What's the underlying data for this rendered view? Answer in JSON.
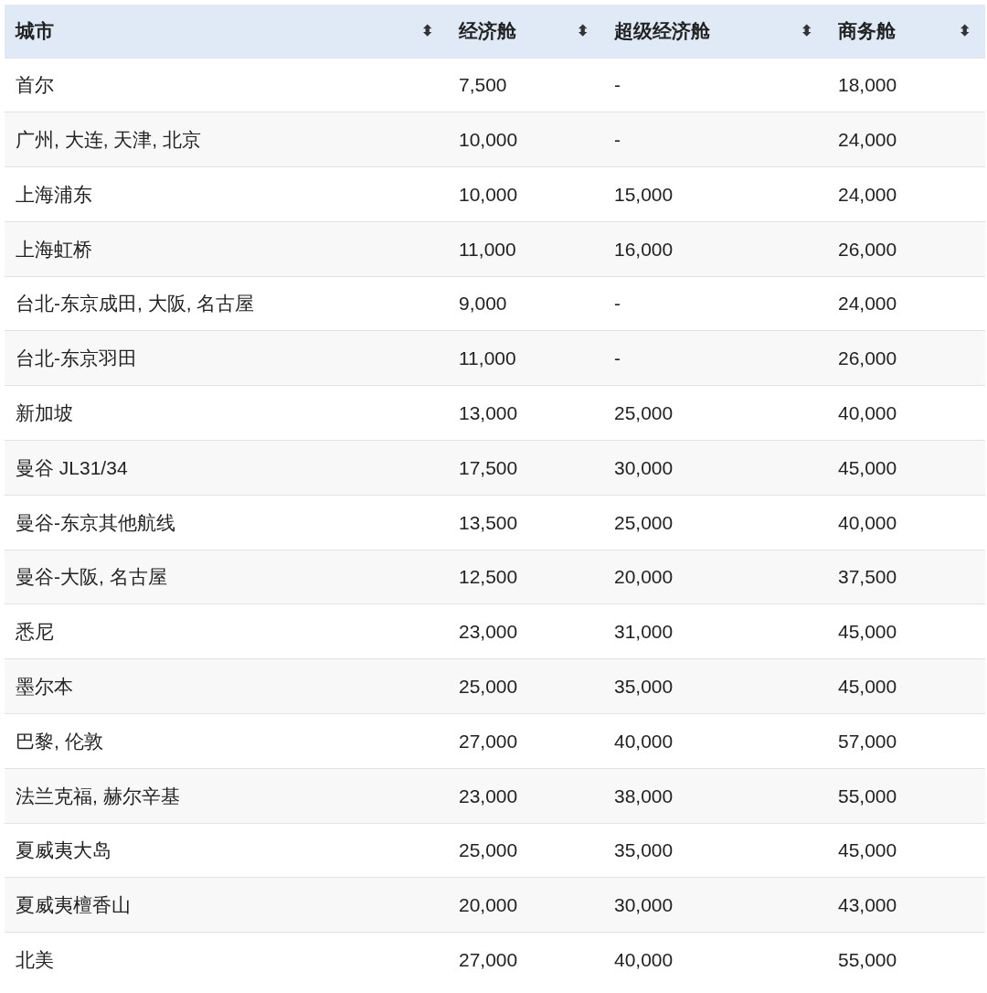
{
  "table": {
    "columns": [
      {
        "label": "城市",
        "sort_icon": "⬍"
      },
      {
        "label": "经济舱",
        "sort_icon": "⬍"
      },
      {
        "label": "超级经济舱",
        "sort_icon": "⬍"
      },
      {
        "label": "商务舱",
        "sort_icon": "⬍"
      }
    ],
    "rows": [
      [
        "首尔",
        "7,500",
        "-",
        "18,000"
      ],
      [
        "广州, 大连, 天津, 北京",
        "10,000",
        "-",
        "24,000"
      ],
      [
        "上海浦东",
        "10,000",
        "15,000",
        "24,000"
      ],
      [
        "上海虹桥",
        "11,000",
        "16,000",
        "26,000"
      ],
      [
        "台北-东京成田, 大阪, 名古屋",
        "9,000",
        "-",
        "24,000"
      ],
      [
        "台北-东京羽田",
        "11,000",
        "-",
        "26,000"
      ],
      [
        "新加坡",
        "13,000",
        "25,000",
        "40,000"
      ],
      [
        "曼谷 JL31/34",
        "17,500",
        "30,000",
        "45,000"
      ],
      [
        "曼谷-东京其他航线",
        "13,500",
        "25,000",
        "40,000"
      ],
      [
        "曼谷-大阪, 名古屋",
        "12,500",
        "20,000",
        "37,500"
      ],
      [
        "悉尼",
        "23,000",
        "31,000",
        "45,000"
      ],
      [
        "墨尔本",
        "25,000",
        "35,000",
        "45,000"
      ],
      [
        "巴黎, 伦敦",
        "27,000",
        "40,000",
        "57,000"
      ],
      [
        "法兰克福, 赫尔辛基",
        "23,000",
        "38,000",
        "55,000"
      ],
      [
        "夏威夷大岛",
        "25,000",
        "35,000",
        "45,000"
      ],
      [
        "夏威夷檀香山",
        "20,000",
        "30,000",
        "43,000"
      ],
      [
        "北美",
        "27,000",
        "40,000",
        "55,000"
      ]
    ]
  }
}
